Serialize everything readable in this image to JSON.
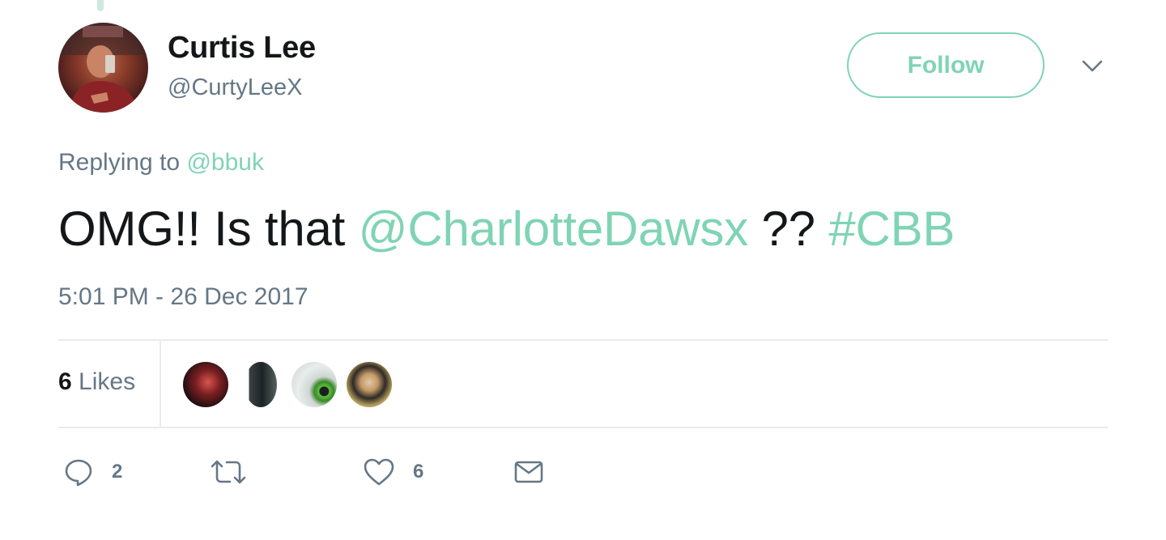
{
  "author": {
    "name": "Curtis Lee",
    "handle": "@CurtyLeeX"
  },
  "follow_label": "Follow",
  "reply_context": {
    "prefix": "Replying to",
    "mention": "@bbuk"
  },
  "tweet": {
    "part1": "OMG!! Is that ",
    "mention": "@CharlotteDawsx",
    "part2": " ?? ",
    "hashtag": "#CBB"
  },
  "timestamp": "5:01 PM - 26 Dec 2017",
  "likes": {
    "count": "6",
    "label": "Likes"
  },
  "actions": {
    "replies": "2",
    "retweets": "",
    "likes": "6"
  },
  "colors": {
    "accent": "#7fd4b5",
    "secondary_text": "#657786",
    "primary_text": "#14171a",
    "divider": "#e6ecf0"
  },
  "icons": [
    "caret-down-icon",
    "reply-icon",
    "retweet-icon",
    "heart-icon",
    "envelope-icon"
  ]
}
